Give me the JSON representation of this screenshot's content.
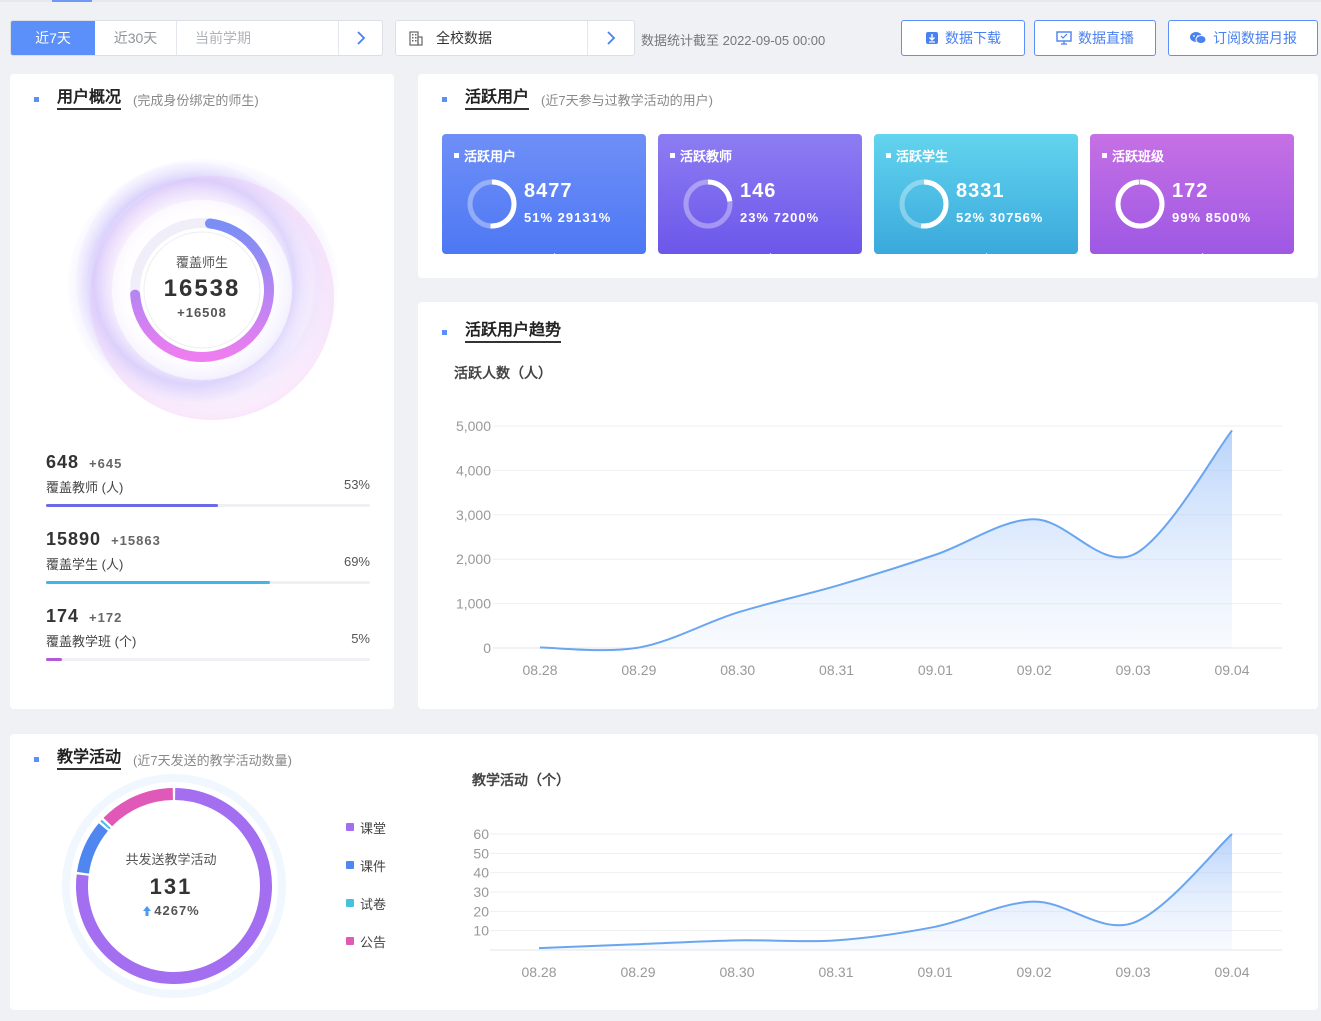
{
  "toolbar": {
    "range_tabs": [
      "近7天",
      "近30天",
      "当前学期"
    ],
    "scope_label": "全校数据",
    "stat_time": "数据统计截至 2022-09-05 00:00",
    "buttons": [
      "数据下载",
      "数据直播",
      "订阅数据月报"
    ]
  },
  "user_overview": {
    "title": "用户概况",
    "subtitle": "(完成身份绑定的师生)",
    "center_label": "覆盖师生",
    "center_value": "16538",
    "center_inc": "+16508",
    "ring_fraction": 0.72,
    "stats": [
      {
        "value": "648",
        "inc": "+645",
        "label": "覆盖教师 (人)",
        "pct": "53%",
        "fraction": 0.53,
        "color": "#6d6ae8"
      },
      {
        "value": "15890",
        "inc": "+15863",
        "label": "覆盖学生 (人)",
        "pct": "69%",
        "fraction": 0.69,
        "color": "#3fb6e8"
      },
      {
        "value": "174",
        "inc": "+172",
        "label": "覆盖教学班 (个)",
        "pct": "5%",
        "fraction": 0.05,
        "color": "#b059e0"
      }
    ]
  },
  "active_users": {
    "title": "活跃用户",
    "subtitle": "(近7天参与过教学活动的用户)",
    "tiles": [
      {
        "label": "活跃用户",
        "value": "8477",
        "pct": "51%",
        "inc": "29131%",
        "fraction": 0.51,
        "color_a": "#6f8ff7",
        "color_b": "#4d78f4"
      },
      {
        "label": "活跃教师",
        "value": "146",
        "pct": "23%",
        "inc": "7200%",
        "fraction": 0.23,
        "color_a": "#8d7df2",
        "color_b": "#6b57ea"
      },
      {
        "label": "活跃学生",
        "value": "8331",
        "pct": "52%",
        "inc": "30756%",
        "fraction": 0.52,
        "color_a": "#62d4ee",
        "color_b": "#3aa9dc"
      },
      {
        "label": "活跃班级",
        "value": "172",
        "pct": "99%",
        "inc": "8500%",
        "fraction": 0.99,
        "color_a": "#c670e4",
        "color_b": "#9e58e4"
      }
    ]
  },
  "trend": {
    "title": "活跃用户趋势",
    "ylabel": "活跃人数（人）"
  },
  "teaching": {
    "title": "教学活动",
    "subtitle": "(近7天发送的教学活动数量)",
    "center_label": "共发送教学活动",
    "center_value": "131",
    "center_inc": "4267%",
    "legend": [
      {
        "label": "课堂",
        "color": "#a36ef0"
      },
      {
        "label": "课件",
        "color": "#4f86f0"
      },
      {
        "label": "试卷",
        "color": "#46c1de"
      },
      {
        "label": "公告",
        "color": "#e058b8"
      }
    ],
    "ylabel": "教学活动（个）"
  },
  "chart_data": [
    {
      "type": "area",
      "x": [
        "08.28",
        "08.29",
        "08.30",
        "08.31",
        "09.01",
        "09.02",
        "09.03",
        "09.04"
      ],
      "series": [
        {
          "values": [
            10,
            10,
            800,
            1400,
            2100,
            2900,
            2100,
            4900
          ]
        }
      ],
      "ylabel": "活跃人数（人）",
      "yticks": [
        "0",
        "1,000",
        "2,000",
        "3,000",
        "4,000",
        "5,000"
      ],
      "ylim": [
        0,
        5000
      ],
      "grid": true
    },
    {
      "type": "area",
      "x": [
        "08.28",
        "08.29",
        "08.30",
        "08.31",
        "09.01",
        "09.02",
        "09.03",
        "09.04"
      ],
      "series": [
        {
          "values": [
            1,
            3,
            5,
            5,
            12,
            25,
            14,
            60
          ]
        }
      ],
      "ylabel": "教学活动（个）",
      "yticks": [
        "10",
        "20",
        "30",
        "40",
        "50",
        "60"
      ],
      "ylim": [
        0,
        60
      ],
      "grid": true
    },
    {
      "type": "pie",
      "categories": [
        "课堂",
        "课件",
        "试卷",
        "公告"
      ],
      "values": [
        101,
        12,
        1,
        17
      ]
    }
  ]
}
